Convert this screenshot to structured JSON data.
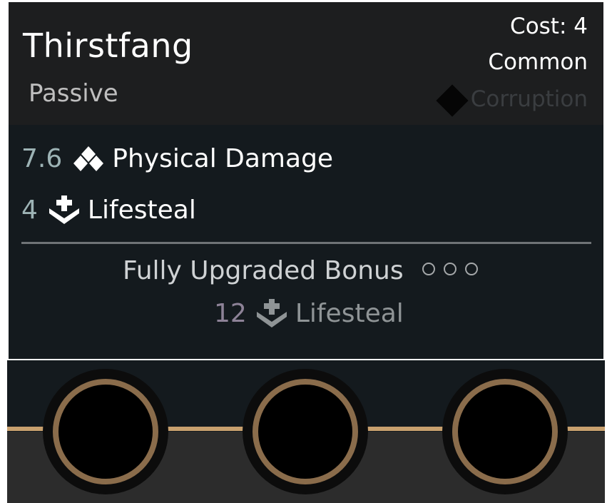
{
  "card": {
    "title": "Thirstfang",
    "type": "Passive",
    "cost": "Cost: 4",
    "rarity": "Common",
    "family": "Corruption",
    "stats": [
      {
        "value": "7.6",
        "icon": "physical-damage-icon",
        "label": "Physical Damage"
      },
      {
        "value": "4",
        "icon": "lifesteal-icon",
        "label": "Lifesteal"
      }
    ],
    "bonus": {
      "title": "Fully Upgraded Bonus",
      "upgrade_pips": 3,
      "value": "12",
      "icon": "lifesteal-icon",
      "label": "Lifesteal"
    },
    "sockets": 3
  },
  "colors": {
    "card_bg": "#141a1e",
    "header_bg": "#1d1e1f",
    "stat_value": "#9db3b5",
    "bonus_value": "#8d8297",
    "socket_ring": "#8a6c4b",
    "socket_line": "#c8a06e"
  }
}
